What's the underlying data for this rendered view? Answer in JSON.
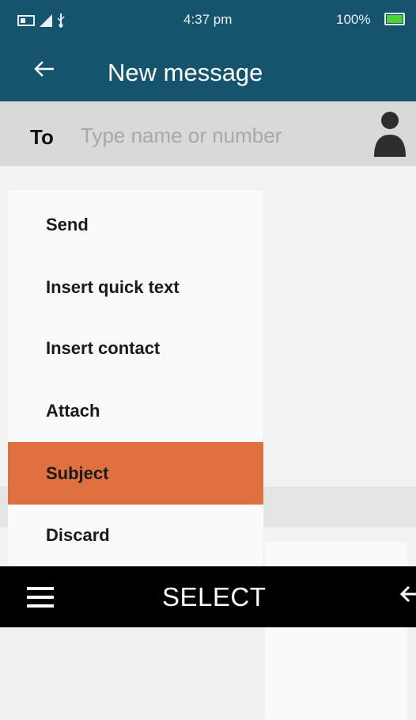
{
  "status_bar": {
    "time": "4:37 pm",
    "battery_percent": "100%",
    "battery_level": 1.0,
    "icons": [
      "sim-card-icon",
      "signal-icon",
      "usb-icon"
    ]
  },
  "app_bar": {
    "back_icon": "arrow-left-icon",
    "title": "New message"
  },
  "recipient": {
    "label": "To",
    "placeholder": "Type name or number",
    "value": "",
    "contact_icon": "person-icon"
  },
  "options_menu": {
    "items": [
      {
        "label": "Send",
        "selected": false
      },
      {
        "label": "Insert quick text",
        "selected": false
      },
      {
        "label": "Insert contact",
        "selected": false
      },
      {
        "label": "Attach",
        "selected": false
      },
      {
        "label": "Subject",
        "selected": true
      },
      {
        "label": "Discard",
        "selected": false
      }
    ]
  },
  "soft_keys": {
    "left_icon": "hamburger-menu-icon",
    "center_label": "SELECT",
    "right_icon": "back-arrow-icon"
  },
  "colors": {
    "header": "#16546e",
    "selected_item": "#e07040",
    "soft_key_bar": "#000000"
  }
}
